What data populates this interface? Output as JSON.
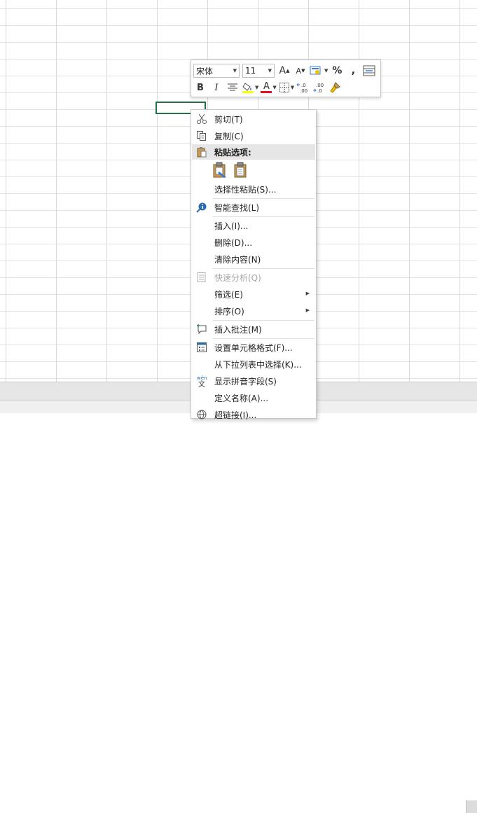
{
  "toolbar": {
    "font_name": "宋体",
    "font_size": "11",
    "grow_font": "A",
    "shrink_font": "A",
    "percent": "%",
    "comma": ",",
    "bold": "B",
    "italic": "I",
    "font_color_letter": "A",
    "decimal_increase": ".0→.00",
    "decimal_decrease": ".00→.0",
    "fill_color": "#ffff00",
    "font_color": "#e81123"
  },
  "menu": {
    "cut": "剪切(T)",
    "copy": "复制(C)",
    "paste_options": "粘贴选项:",
    "paste_special": "选择性粘贴(S)...",
    "smart_lookup": "智能查找(L)",
    "insert": "插入(I)...",
    "delete": "删除(D)...",
    "clear": "清除内容(N)",
    "quick_analysis": "快速分析(Q)",
    "filter": "筛选(E)",
    "sort": "排序(O)",
    "insert_comment": "插入批注(M)",
    "format_cells": "设置单元格格式(F)...",
    "pick_from_list": "从下拉列表中选择(K)...",
    "phonetic": "显示拼音字段(S)",
    "define_name": "定义名称(A)...",
    "hyperlink": "超链接(I)..."
  },
  "colors": {
    "active_cell_border": "#217346",
    "menu_header_bg": "#e6e6e6"
  }
}
